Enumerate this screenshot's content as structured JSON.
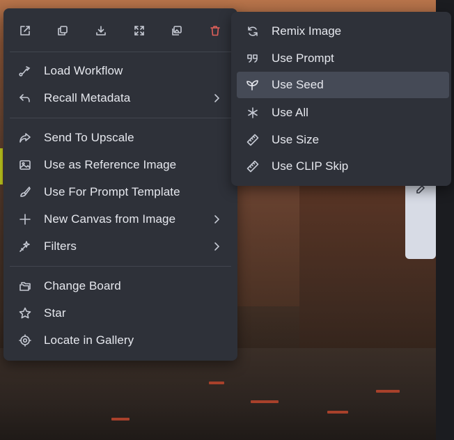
{
  "toolbar": {
    "icons": [
      "external-link-icon",
      "copy-icon",
      "download-icon",
      "expand-icon",
      "image-icon",
      "trash-icon"
    ]
  },
  "main_menu": {
    "items": [
      {
        "label": "Load Workflow",
        "icon": "workflow-icon",
        "submenu": false
      },
      {
        "label": "Recall Metadata",
        "icon": "undo-arrow-icon",
        "submenu": true
      },
      {
        "label": "Send To Upscale",
        "icon": "share-arrow-icon",
        "submenu": false
      },
      {
        "label": "Use as Reference Image",
        "icon": "image-icon",
        "submenu": false
      },
      {
        "label": "Use For Prompt Template",
        "icon": "paint-brush-icon",
        "submenu": false
      },
      {
        "label": "New Canvas from Image",
        "icon": "plus-icon",
        "submenu": true
      },
      {
        "label": "Filters",
        "icon": "magic-wand-icon",
        "submenu": true
      },
      {
        "label": "Change Board",
        "icon": "folders-icon",
        "submenu": false
      },
      {
        "label": "Star",
        "icon": "star-icon",
        "submenu": false
      },
      {
        "label": "Locate in Gallery",
        "icon": "crosshair-icon",
        "submenu": false
      }
    ]
  },
  "sub_menu": {
    "items": [
      {
        "label": "Remix Image",
        "icon": "refresh-icon"
      },
      {
        "label": "Use Prompt",
        "icon": "quote-icon"
      },
      {
        "label": "Use Seed",
        "icon": "plant-icon",
        "active": true
      },
      {
        "label": "Use All",
        "icon": "asterisk-icon"
      },
      {
        "label": "Use Size",
        "icon": "ruler-icon"
      },
      {
        "label": "Use CLIP Skip",
        "icon": "ruler-icon"
      }
    ]
  },
  "colors": {
    "menu_bg": "#2e3139",
    "active_bg": "#454a56",
    "text": "#e6e8ee",
    "icon": "#c5c9d3",
    "delete_icon": "#e0605a",
    "accent": "#c8d21e"
  }
}
